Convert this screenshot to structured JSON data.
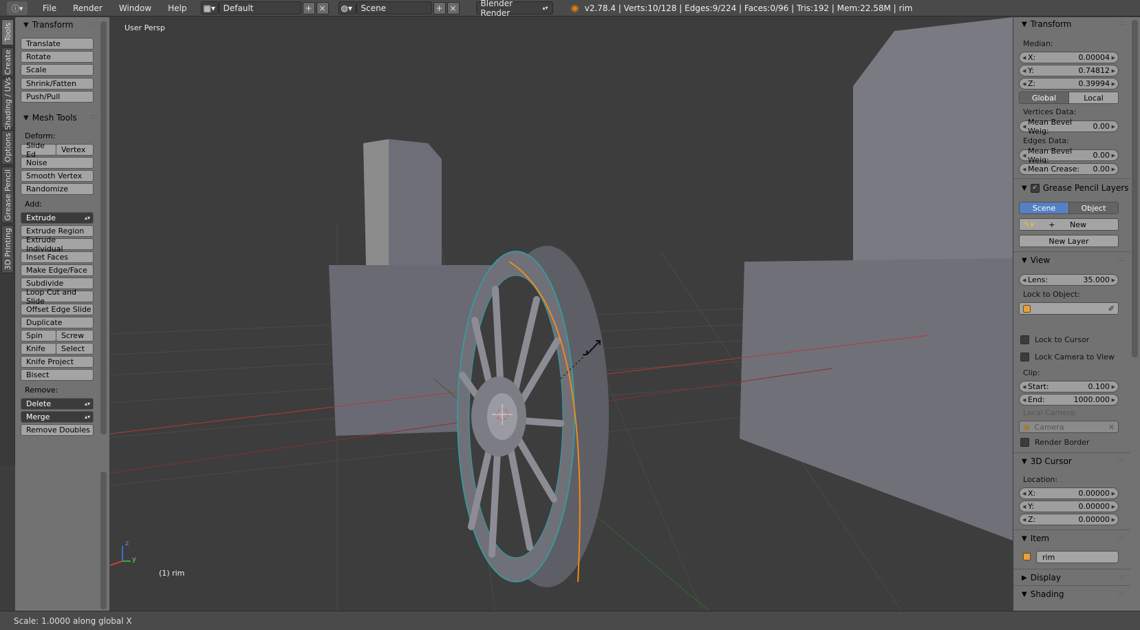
{
  "header": {
    "menus": [
      "File",
      "Render",
      "Window",
      "Help"
    ],
    "layout": "Default",
    "scene": "Scene",
    "engine": "Blender Render",
    "stats": "v2.78.4 | Verts:10/128 | Edges:9/224 | Faces:0/96 | Tris:192 | Mem:22.58M | rim"
  },
  "tabs": [
    "Tools",
    "Create",
    "Shading / UVs",
    "Options",
    "Grease Pencil",
    "3D Printing"
  ],
  "toolshelf": {
    "transform_title": "Transform",
    "transform_buttons": [
      "Translate",
      "Rotate",
      "Scale",
      "Shrink/Fatten",
      "Push/Pull"
    ],
    "mesh_tools_title": "Mesh Tools",
    "deform_label": "Deform:",
    "slide_edge": "Slide Ed",
    "vertex": "Vertex",
    "deform_buttons": [
      "Noise",
      "Smooth Vertex",
      "Randomize"
    ],
    "add_label": "Add:",
    "extrude_select": "Extrude",
    "add_buttons": [
      "Extrude Region",
      "Extrude Individual",
      "Inset Faces",
      "Make Edge/Face",
      "Subdivide",
      "Loop Cut and Slide",
      "Offset Edge Slide",
      "Duplicate"
    ],
    "spin": "Spin",
    "screw": "Screw",
    "knife": "Knife",
    "select": "Select",
    "knife_project": "Knife Project",
    "bisect": "Bisect",
    "remove_label": "Remove:",
    "delete_select": "Delete",
    "merge_select": "Merge",
    "remove_doubles": "Remove Doubles"
  },
  "viewport": {
    "view_name": "User Persp",
    "object_label": "(1) rim",
    "axis_z": "z",
    "axis_y": "y"
  },
  "properties": {
    "transform_title": "Transform",
    "median_label": "Median:",
    "x_label": "X:",
    "x_value": "0.00004",
    "y_label": "Y:",
    "y_value": "0.74812",
    "z_label": "Z:",
    "z_value": "0.39994",
    "global": "Global",
    "local": "Local",
    "vertices_data": "Vertices Data:",
    "mean_bevel_label": "Mean Bevel Weig:",
    "mean_bevel_v": "0.00",
    "edges_data": "Edges Data:",
    "mean_bevel_e": "0.00",
    "mean_crease_label": "Mean Crease:",
    "mean_crease": "0.00",
    "grease_title": "Grease Pencil Layers",
    "scene_btn": "Scene",
    "object_btn": "Object",
    "new_btn": "New",
    "new_layer_btn": "New Layer",
    "view_title": "View",
    "lens_label": "Lens:",
    "lens_value": "35.000",
    "lock_to_object": "Lock to Object:",
    "lock_cursor": "Lock to Cursor",
    "lock_camera": "Lock Camera to View",
    "clip_label": "Clip:",
    "start_label": "Start:",
    "start_value": "0.100",
    "end_label": "End:",
    "end_value": "1000.000",
    "local_camera": "Local Camera:",
    "camera": "Camera",
    "render_border": "Render Border",
    "cursor_title": "3D Cursor",
    "location_label": "Location:",
    "cx": "0.00000",
    "cy": "0.00000",
    "cz": "0.00000",
    "item_title": "Item",
    "item_name": "rim",
    "display_title": "Display",
    "shading_title": "Shading"
  },
  "status": "Scale: 1.0000 along global X"
}
